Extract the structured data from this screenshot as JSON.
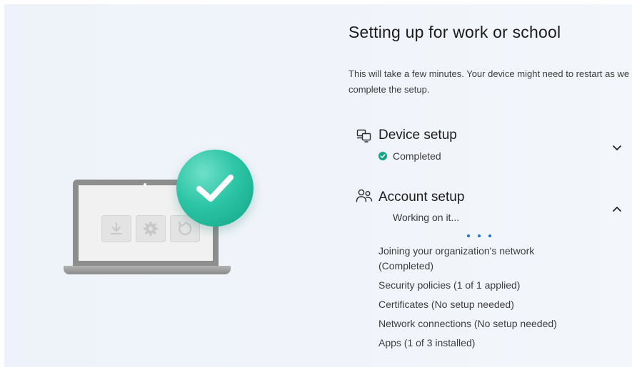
{
  "title": "Setting up for work or school",
  "subtitle": "This will take a few minutes. Your device might need to restart as we complete the setup.",
  "device_setup": {
    "title": "Device setup",
    "status": "Completed",
    "icon": "device-setup-icon",
    "expanded": false
  },
  "account_setup": {
    "title": "Account setup",
    "status": "Working on it...",
    "icon": "people-icon",
    "expanded": true,
    "items": [
      "Joining your organization's network (Completed)",
      "Security policies (1 of 1 applied)",
      "Certificates (No setup needed)",
      "Network connections (No setup needed)",
      "Apps (1 of 3 installed)"
    ]
  },
  "colors": {
    "success": "#13a486",
    "progress_dots": "#1f6fd1"
  }
}
